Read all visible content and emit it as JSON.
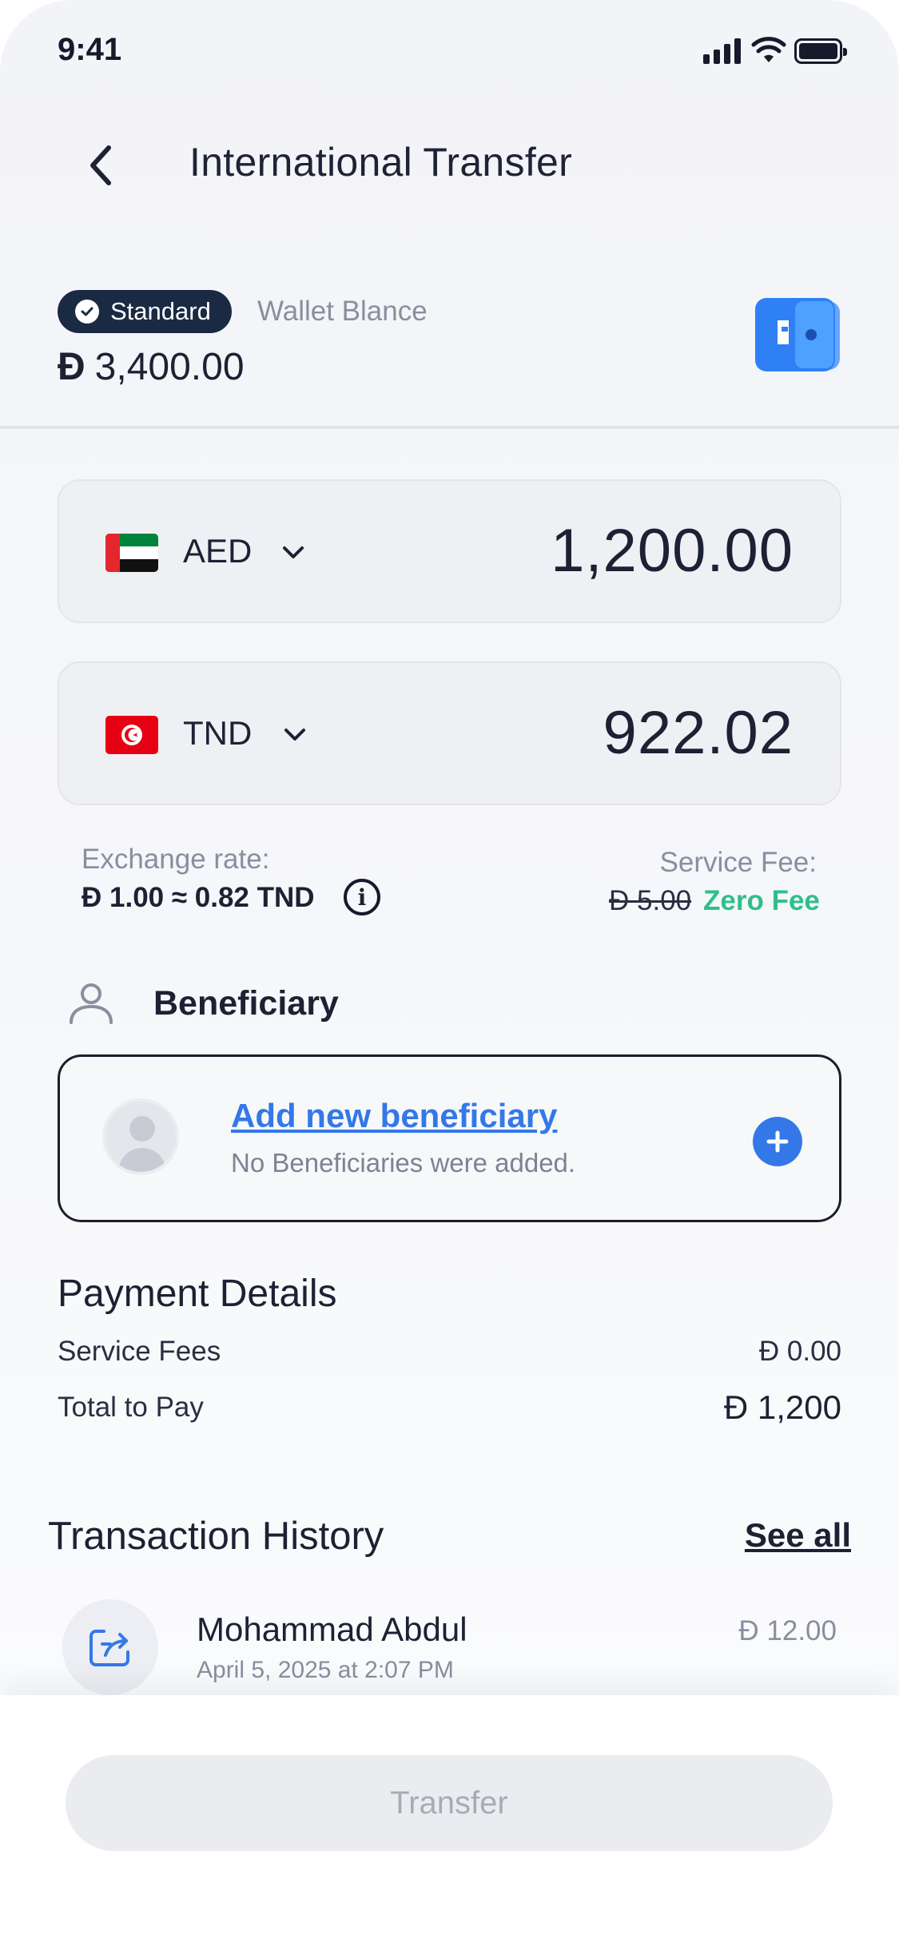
{
  "status_bar": {
    "time": "9:41"
  },
  "header": {
    "title": "International Transfer"
  },
  "wallet": {
    "tier": "Standard",
    "label": "Wallet Blance",
    "currency_symbol": "Đ",
    "balance": "3,400.00"
  },
  "from_currency": {
    "code": "AED",
    "amount": "1,200.00"
  },
  "to_currency": {
    "code": "TND",
    "amount": "922.02"
  },
  "exchange": {
    "label": "Exchange rate:",
    "value": "Đ 1.00 ≈ 0.82 TND",
    "fee_label": "Service Fee:",
    "fee_old": "Đ 5.00",
    "fee_new": "Zero Fee"
  },
  "beneficiary": {
    "title": "Beneficiary",
    "add_label": "Add new beneficiary",
    "empty_text": "No Beneficiaries were added."
  },
  "payment_details": {
    "title": "Payment Details",
    "rows": [
      {
        "label": "Service Fees",
        "value": "Đ 0.00"
      },
      {
        "label": "Total to Pay",
        "value": "Đ 1,200"
      }
    ]
  },
  "history": {
    "title": "Transaction History",
    "see_all": "See all",
    "items": [
      {
        "name": "Mohammad Abdul",
        "date": "April 5, 2025 at 2:07 PM",
        "amount": "Đ 12.00"
      }
    ]
  },
  "actions": {
    "transfer_label": "Transfer"
  },
  "colors": {
    "accent": "#3478e8",
    "badge": "#1b2a43",
    "zero_fee": "#2fbf8a",
    "button_disabled": "#ebecf0"
  }
}
